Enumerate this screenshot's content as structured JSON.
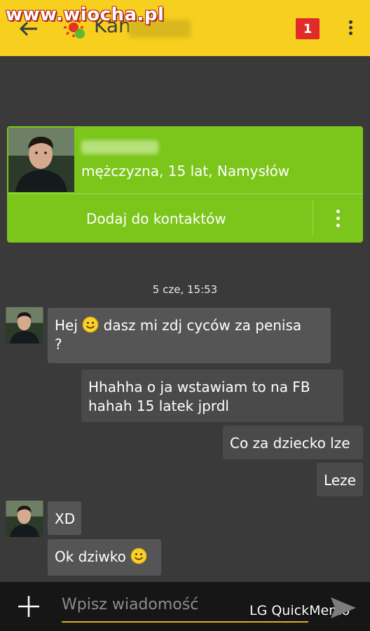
{
  "watermark": {
    "text": "www.wiocha.pl"
  },
  "header": {
    "contact_name": "Kan",
    "notification_count": "1",
    "background": "#f7cf1e"
  },
  "profile_card": {
    "info": "mężczyzna, 15 lat, Namysłów",
    "add_contact_label": "Dodaj do kontaktów",
    "background": "#7cc51a"
  },
  "chat": {
    "timestamp": "5 cze, 15:53",
    "messages": [
      {
        "dir": "in",
        "before_emoji": "Hej ",
        "after_emoji": " dasz mi zdj cyców za penisa",
        "line2": "?"
      },
      {
        "dir": "out",
        "line1": "Hhahha o ja wstawiam to na FB",
        "line2": "hahah 15 latek jprdl"
      },
      {
        "dir": "out",
        "text": "Co za dziecko lze"
      },
      {
        "dir": "out",
        "text": "Leze"
      },
      {
        "dir": "in",
        "text": "XD"
      },
      {
        "dir": "in",
        "before_emoji": "Ok dziwko ",
        "after_emoji": ""
      }
    ]
  },
  "input": {
    "placeholder": "Wpisz wiadomość",
    "accent": "#d9b21d"
  },
  "overlay": {
    "quickmemo_label": "LG QuickMemo"
  }
}
